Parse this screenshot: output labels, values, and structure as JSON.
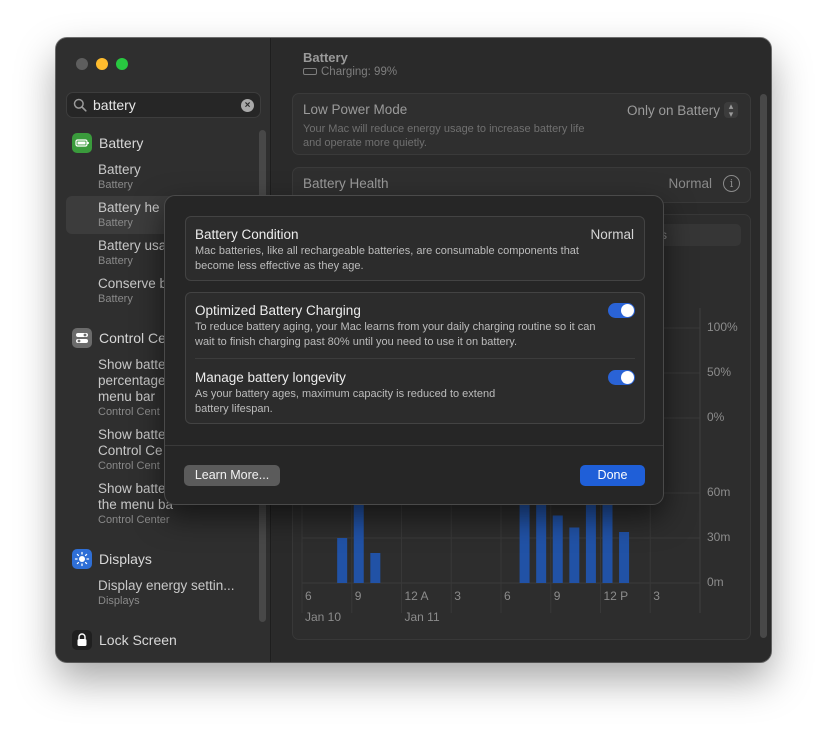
{
  "window": {
    "controls": [
      "close",
      "minimize",
      "zoom"
    ]
  },
  "search": {
    "value": "battery",
    "clear_icon": "clear-icon"
  },
  "sidebar": {
    "categories": [
      {
        "label": "Battery",
        "icon": "battery-icon",
        "color": "#3a9b3c"
      },
      {
        "label": "Control Ce",
        "icon": "control-center-icon",
        "color": "#6b6b6b"
      },
      {
        "label": "Displays",
        "icon": "displays-icon",
        "color": "#2f6fd6"
      },
      {
        "label": "Lock Screen",
        "icon": "lock-icon",
        "color": "#3b3b3b"
      }
    ],
    "battery_results": [
      {
        "title": "Battery",
        "sub": "Battery"
      },
      {
        "title": "Battery he",
        "sub": "Battery"
      },
      {
        "title": "Battery usa",
        "sub": "Battery"
      },
      {
        "title": "Conserve b",
        "sub": "Battery"
      }
    ],
    "control_results": [
      {
        "lines": [
          "Show batte",
          "percentage",
          "menu bar"
        ],
        "sub": "Control Cent"
      },
      {
        "lines": [
          "Show batte",
          "Control Ce"
        ],
        "sub": "Control Cent"
      },
      {
        "lines": [
          "Show batte",
          "the menu ba"
        ],
        "sub": "Control Center"
      }
    ],
    "display_results": [
      {
        "title": "Display energy settin...",
        "sub": "Displays"
      }
    ]
  },
  "main": {
    "title": "Battery",
    "subtitle": "Charging: 99%",
    "low_power": {
      "label": "Low Power Mode",
      "value": "Only on Battery",
      "description": "Your Mac will reduce energy usage to increase battery life and operate more quietly."
    },
    "battery_health": {
      "label": "Battery Health",
      "value": "Normal"
    },
    "partial_tab_text": "s"
  },
  "chart_data": [
    {
      "type": "bar",
      "ylabel_ticks": [
        "100%",
        "50%",
        "0%"
      ],
      "note": ""
    },
    {
      "type": "bar",
      "x_ticks": [
        "6",
        "9",
        "12 A",
        "3",
        "6",
        "9",
        "12 P",
        "3"
      ],
      "x_dates": [
        "Jan 10",
        "Jan 11"
      ],
      "y_ticks": [
        "60m",
        "30m",
        "0m"
      ],
      "ylim": [
        0,
        60
      ],
      "bar_color": "#2152a6",
      "bars": [
        {
          "x": 8.0,
          "value": 30
        },
        {
          "x": 9.0,
          "value": 53
        },
        {
          "x": 10.0,
          "value": 20
        },
        {
          "x": 19.0,
          "value": 55
        },
        {
          "x": 20.0,
          "value": 52
        },
        {
          "x": 21.0,
          "value": 45
        },
        {
          "x": 22.0,
          "value": 37
        },
        {
          "x": 23.0,
          "value": 54
        },
        {
          "x": 24.0,
          "value": 53
        },
        {
          "x": 25.0,
          "value": 34
        }
      ]
    }
  ],
  "modal": {
    "condition": {
      "title": "Battery Condition",
      "value": "Normal",
      "description": "Mac batteries, like all rechargeable batteries, are consumable components that become less effective as they age."
    },
    "optimized": {
      "title": "Optimized Battery Charging",
      "enabled": true,
      "description": "To reduce battery aging, your Mac learns from your daily charging routine so it can wait to finish charging past 80% until you need to use it on battery."
    },
    "longevity": {
      "title": "Manage battery longevity",
      "enabled": true,
      "description": "As your battery ages, maximum capacity is reduced to extend battery lifespan."
    },
    "learn_more": "Learn More...",
    "done": "Done"
  }
}
